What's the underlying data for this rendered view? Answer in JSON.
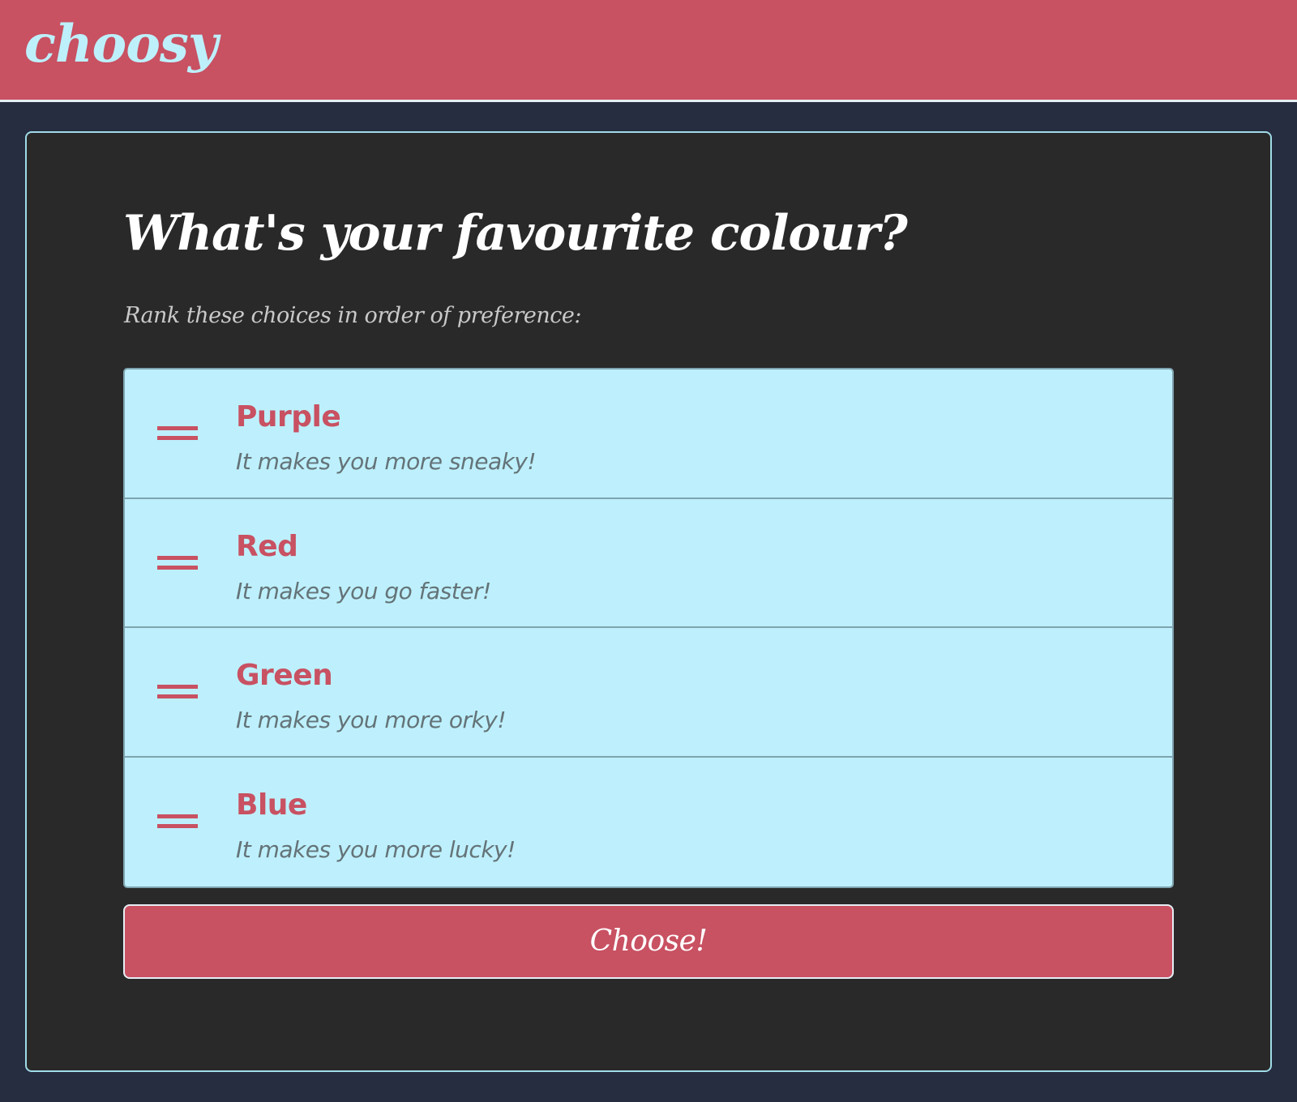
{
  "header": {
    "logo": "choosy"
  },
  "poll": {
    "question": "What's your favourite colour?",
    "instructions": "Rank these choices in order of preference:",
    "choices": [
      {
        "name": "Purple",
        "description": "It makes you more sneaky!"
      },
      {
        "name": "Red",
        "description": "It makes you go faster!"
      },
      {
        "name": "Green",
        "description": "It makes you more orky!"
      },
      {
        "name": "Blue",
        "description": "It makes you more lucky!"
      }
    ],
    "submit_label": "Choose!"
  },
  "colors": {
    "header_bg": "#c85162",
    "page_bg": "#262d40",
    "panel_bg": "#292929",
    "logo_text": "#bdf0fb",
    "list_bg": "#bdf0fc",
    "accent": "#c85162",
    "description_text": "#647378"
  },
  "icons": {
    "drag_handle": "drag-handle-icon"
  }
}
